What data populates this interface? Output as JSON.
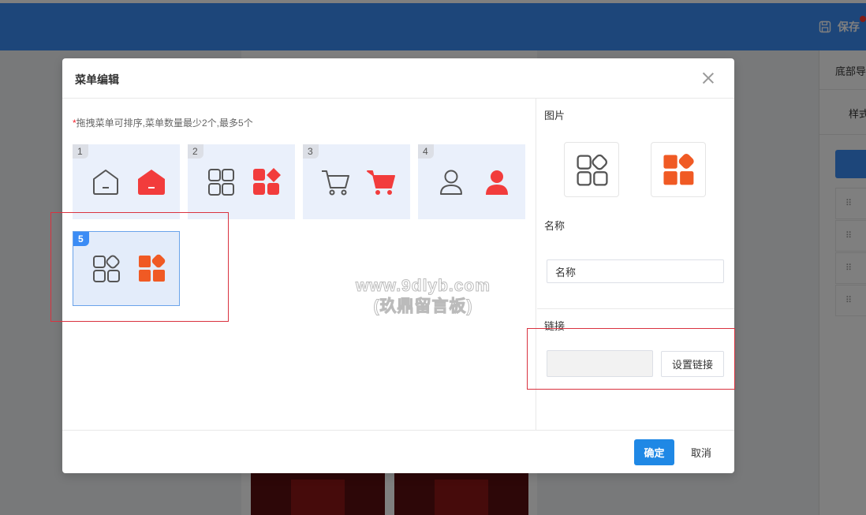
{
  "topbar": {
    "save_label": "保存",
    "save_icon": "save-icon",
    "accent_color": "#3b8cf5"
  },
  "background_panel": {
    "tab_bottom_nav": "底部导",
    "tab_style": "样式"
  },
  "dialog": {
    "title": "菜单编辑",
    "tip_star": "*",
    "tip": "拖拽菜单可排序,菜单数量最少2个,最多5个",
    "menu_items": [
      {
        "num": "1",
        "icon": "home-icon",
        "active_icon": "home-filled-icon",
        "active_color": "#f23c3c"
      },
      {
        "num": "2",
        "icon": "grid-icon",
        "active_icon": "grid-filled-icon",
        "active_color": "#f23c3c"
      },
      {
        "num": "3",
        "icon": "cart-icon",
        "active_icon": "cart-filled-icon",
        "active_color": "#f23c3c"
      },
      {
        "num": "4",
        "icon": "user-icon",
        "active_icon": "user-filled-icon",
        "active_color": "#f23c3c"
      },
      {
        "num": "5",
        "icon": "apps-icon",
        "active_icon": "apps-filled-icon",
        "active_color": "#f05a24"
      }
    ],
    "watermark_line1": "www.9dlyb.com",
    "watermark_line2": "(玖鼎留言板)",
    "image_label": "图片",
    "name_label": "名称",
    "name_value": "名称",
    "link_label": "链接",
    "link_value": "",
    "set_link_label": "设置链接",
    "ok_label": "确定",
    "cancel_label": "取消"
  }
}
